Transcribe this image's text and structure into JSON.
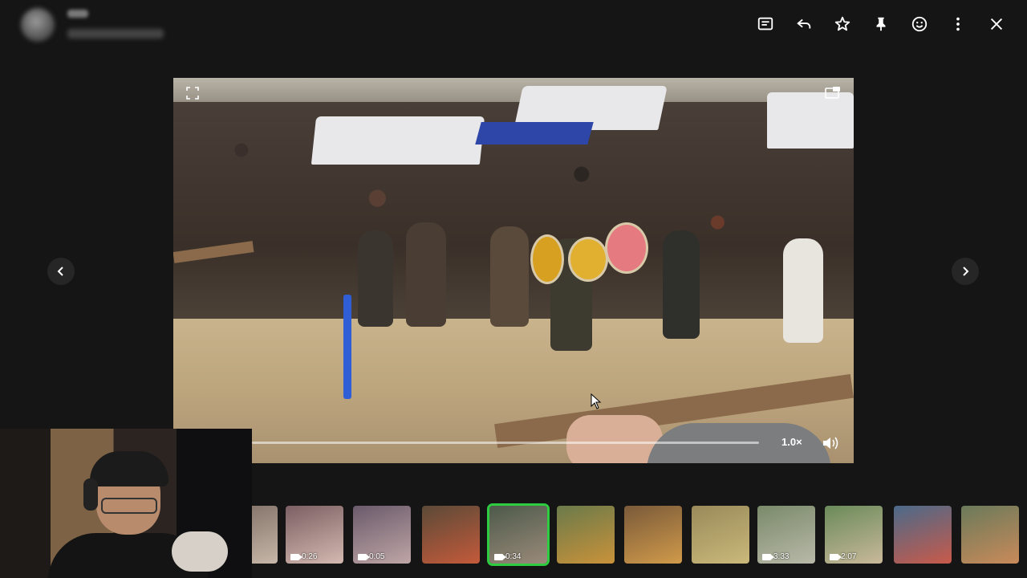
{
  "topbar": {
    "actions": [
      "caption-icon",
      "reply-icon",
      "star-icon",
      "pin-icon",
      "emoji-icon",
      "more-icon",
      "close-icon"
    ]
  },
  "viewer": {
    "speed_label": "1.0×"
  },
  "filmstrip": {
    "thumbs": [
      {
        "duration": "",
        "video": false,
        "colors": [
          "#7b6b62",
          "#c7b7a8"
        ]
      },
      {
        "duration": "0:26",
        "video": true,
        "colors": [
          "#7c5f63",
          "#d3b9b0"
        ]
      },
      {
        "duration": "0:05",
        "video": true,
        "colors": [
          "#6a5a6b",
          "#bfa6a6"
        ]
      },
      {
        "duration": "",
        "video": false,
        "colors": [
          "#5b4a38",
          "#c45a3a"
        ]
      },
      {
        "duration": "0:34",
        "video": true,
        "selected": true,
        "colors": [
          "#4d5a4a",
          "#9a8a7a"
        ]
      },
      {
        "duration": "",
        "video": false,
        "colors": [
          "#6a7a4a",
          "#c9923a"
        ]
      },
      {
        "duration": "",
        "video": false,
        "colors": [
          "#7a5a3a",
          "#d09a4a"
        ]
      },
      {
        "duration": "",
        "video": false,
        "colors": [
          "#9a8a5a",
          "#c9b97a"
        ]
      },
      {
        "duration": "3:33",
        "video": true,
        "colors": [
          "#7a8a6a",
          "#b9b9a9"
        ]
      },
      {
        "duration": "2:07",
        "video": true,
        "colors": [
          "#6a8a5a",
          "#c9b99a"
        ]
      },
      {
        "duration": "",
        "video": false,
        "colors": [
          "#4a6a8a",
          "#c95a4a"
        ]
      },
      {
        "duration": "",
        "video": false,
        "colors": [
          "#6a7a5a",
          "#c98a5a"
        ]
      }
    ]
  },
  "colors": {
    "selected_outline": "#2ecc40",
    "background": "#151515"
  }
}
